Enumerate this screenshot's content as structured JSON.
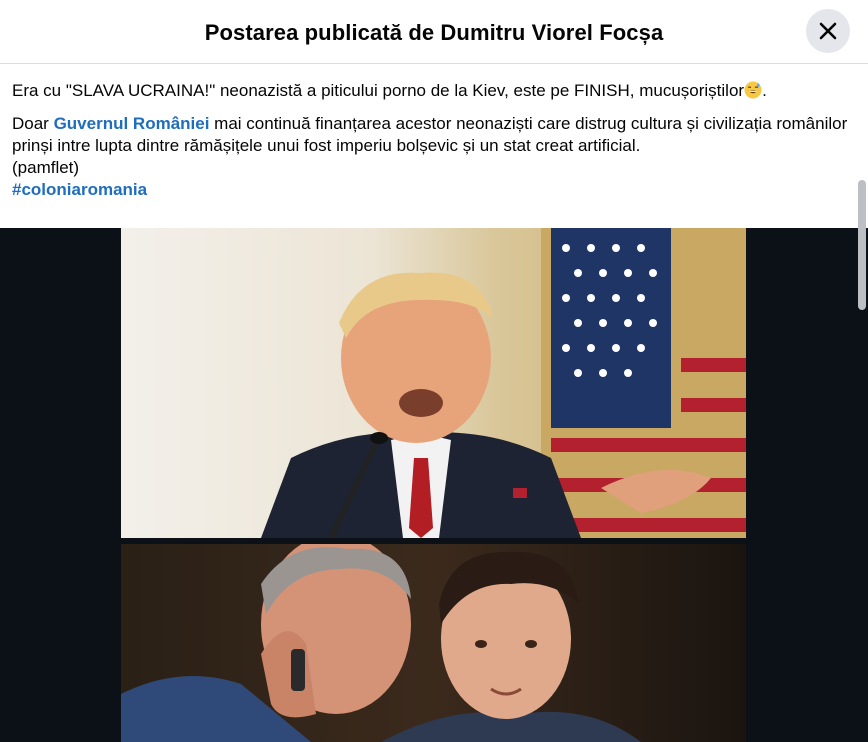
{
  "header": {
    "title": "Postarea publicată de Dumitru Viorel Focșa",
    "close_icon": "close-icon"
  },
  "post": {
    "paragraph1": "Era cu \"SLAVA UCRAINA!\" neonazistă a piticului porno de la Kiev, este pe FINISH, mucușoriștilor",
    "paragraph1_emoji": "grinning-sweat-emoji",
    "paragraph1_end": ".",
    "paragraph2_prefix": "Doar ",
    "paragraph2_link": "Guvernul României",
    "paragraph2_rest": " mai continuă finanțarea acestor neonaziști care distrug cultura și civilizația românilor prinși intre lupta dintre rămășițele unui fost imperiu bolșevic și un stat creat artificial.",
    "paragraph2_note": "(pamflet)",
    "hashtag": "#coloniaromania"
  },
  "colors": {
    "link": "#1f6dbd",
    "text": "#050505",
    "media_background": "#0b1117",
    "close_button_bg": "#e4e6eb"
  }
}
